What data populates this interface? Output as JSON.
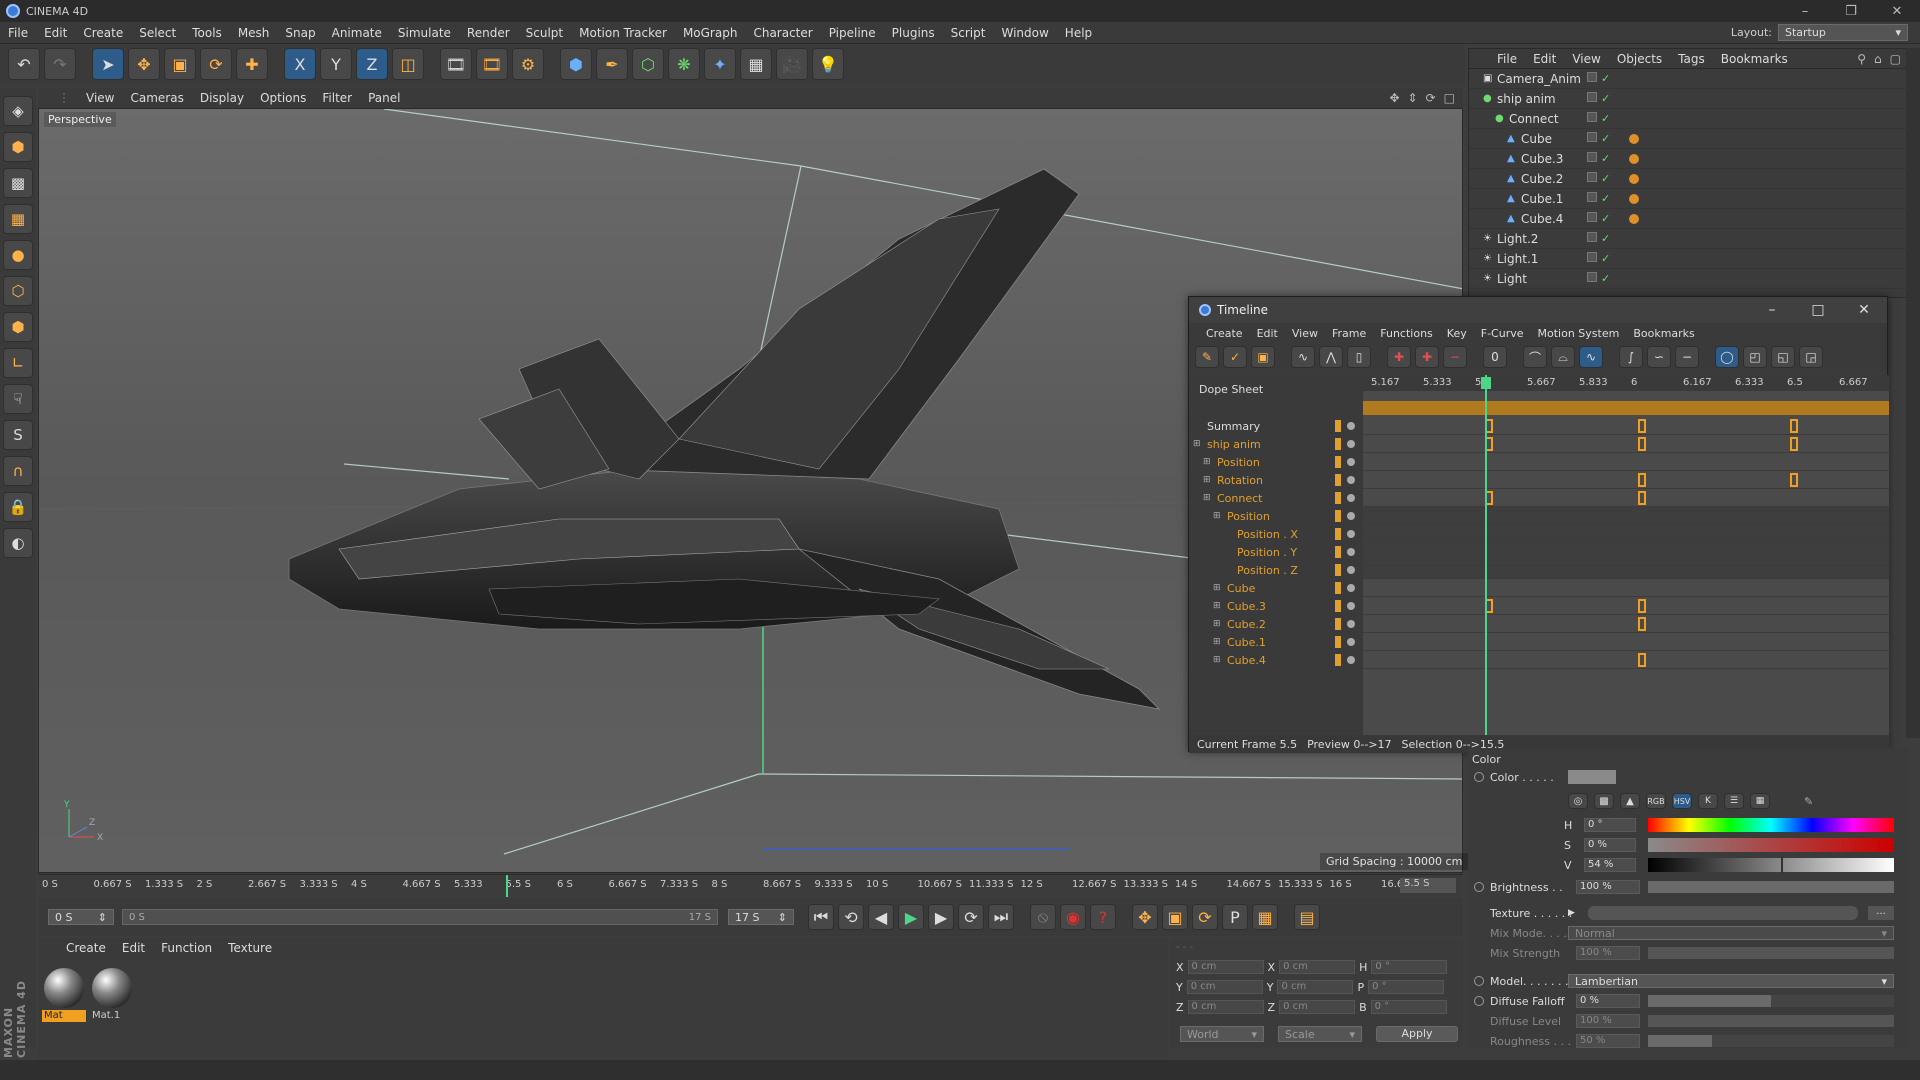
{
  "app": {
    "title": "CINEMA 4D"
  },
  "menu": [
    "File",
    "Edit",
    "Create",
    "Select",
    "Tools",
    "Mesh",
    "Snap",
    "Animate",
    "Simulate",
    "Render",
    "Sculpt",
    "Motion Tracker",
    "MoGraph",
    "Character",
    "Pipeline",
    "Plugins",
    "Script",
    "Window",
    "Help"
  ],
  "layout": {
    "label": "Layout:",
    "value": "Startup"
  },
  "viewport": {
    "menu": [
      "View",
      "Cameras",
      "Display",
      "Options",
      "Filter",
      "Panel"
    ],
    "label": "Perspective",
    "grid_spacing": "Grid Spacing : 10000 cm"
  },
  "objects": {
    "menu": [
      "File",
      "Edit",
      "View",
      "Objects",
      "Tags",
      "Bookmarks"
    ],
    "items": [
      {
        "name": "Camera_Anim",
        "indent": 0
      },
      {
        "name": "ship anim",
        "indent": 0
      },
      {
        "name": "Connect",
        "indent": 1
      },
      {
        "name": "Cube",
        "indent": 2
      },
      {
        "name": "Cube.3",
        "indent": 2
      },
      {
        "name": "Cube.2",
        "indent": 2
      },
      {
        "name": "Cube.1",
        "indent": 2
      },
      {
        "name": "Cube.4",
        "indent": 2
      },
      {
        "name": "Light.2",
        "indent": 0
      },
      {
        "name": "Light.1",
        "indent": 0
      },
      {
        "name": "Light",
        "indent": 0
      }
    ]
  },
  "timeline": {
    "title": "Timeline",
    "menu": [
      "Create",
      "Edit",
      "View",
      "Frame",
      "Functions",
      "Key",
      "F-Curve",
      "Motion System",
      "Bookmarks"
    ],
    "mode": "Dope Sheet",
    "ruler": [
      "5.167",
      "5.333",
      "5.5",
      "5.667",
      "5.833",
      "6",
      "6.167",
      "6.333",
      "6.5",
      "6.667"
    ],
    "tracks": [
      {
        "name": "Summary",
        "indent": 0,
        "keys": [
          0.24,
          0.53,
          0.82
        ]
      },
      {
        "name": "ship anim",
        "indent": 0,
        "keys": [
          0.24,
          0.53,
          0.82
        ]
      },
      {
        "name": "Position",
        "indent": 1,
        "keys": []
      },
      {
        "name": "Rotation",
        "indent": 1,
        "keys": [
          0.53,
          0.82
        ]
      },
      {
        "name": "Connect",
        "indent": 1,
        "keys": [
          0.24,
          0.53
        ]
      },
      {
        "name": "Position",
        "indent": 2,
        "keys": []
      },
      {
        "name": "Position . X",
        "indent": 3,
        "keys": []
      },
      {
        "name": "Position . Y",
        "indent": 3,
        "keys": []
      },
      {
        "name": "Position . Z",
        "indent": 3,
        "keys": []
      },
      {
        "name": "Cube",
        "indent": 2,
        "keys": []
      },
      {
        "name": "Cube.3",
        "indent": 2,
        "keys": [
          0.24,
          0.53
        ]
      },
      {
        "name": "Cube.2",
        "indent": 2,
        "keys": [
          0.53
        ]
      },
      {
        "name": "Cube.1",
        "indent": 2,
        "keys": []
      },
      {
        "name": "Cube.4",
        "indent": 2,
        "keys": [
          0.53
        ]
      }
    ],
    "current_frame": "Current Frame  5.5",
    "preview": "Preview  0-->17",
    "selection": "Selection 0-->15.5"
  },
  "attributes": {
    "section": "Color",
    "color_label": "Color . . . . .",
    "h": "0 °",
    "s": "0 %",
    "v": "54 %",
    "brightness_label": "Brightness . .",
    "brightness": "100 %",
    "texture_label": "Texture . . . . . .",
    "mix_mode_label": "Mix Mode. . . .",
    "mix_mode": "Normal",
    "mix_strength_label": "Mix Strength",
    "mix_strength": "100 %",
    "model_label": "Model. . . . . . .",
    "model": "Lambertian",
    "diffuse_falloff_label": "Diffuse Falloff",
    "diffuse_falloff": "0 %",
    "diffuse_level_label": "Diffuse Level",
    "diffuse_level": "100 %",
    "roughness_label": "Roughness . . .",
    "roughness": "50 %"
  },
  "time_ruler": [
    "0 S",
    "0.667 S",
    "1.333 S",
    "2 S",
    "2.667 S",
    "3.333 S",
    "4 S",
    "4.667 S",
    "5.333",
    "5.5 S",
    "6 S",
    "6.667 S",
    "7.333 S",
    "8 S",
    "8.667 S",
    "9.333 S",
    "10 S",
    "10.667 S",
    "11.333 S",
    "12 S",
    "12.667 S",
    "13.333 S",
    "14 S",
    "14.667 S",
    "15.333 S",
    "16 S",
    "16.667 S"
  ],
  "transport": {
    "start": "0 S",
    "range_start": "0 S",
    "range_end": "17 S",
    "end": "17 S",
    "current": "5.5 S"
  },
  "materials": {
    "menu": [
      "Create",
      "Edit",
      "Function",
      "Texture"
    ],
    "items": [
      "Mat",
      "Mat.1"
    ]
  },
  "coords": {
    "rows": [
      {
        "a": "X",
        "av": "0 cm",
        "b": "X",
        "bv": "0 cm",
        "c": "H",
        "cv": "0 °"
      },
      {
        "a": "Y",
        "av": "0 cm",
        "b": "Y",
        "bv": "0 cm",
        "c": "P",
        "cv": "0 °"
      },
      {
        "a": "Z",
        "av": "0 cm",
        "b": "Z",
        "bv": "0 cm",
        "c": "B",
        "cv": "0 °"
      }
    ],
    "space": "World",
    "mode": "Scale",
    "apply": "Apply"
  },
  "branding": "MAXON CINEMA 4D",
  "colors": {
    "accent": "#f0a020",
    "playhead": "#4dd68a",
    "selection": "#2e5c8a"
  }
}
